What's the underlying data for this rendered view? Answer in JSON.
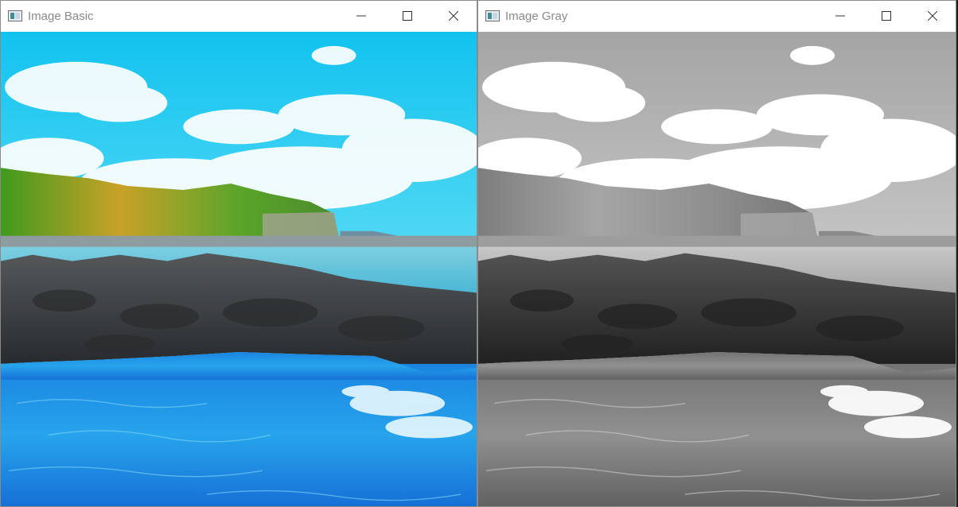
{
  "windows": [
    {
      "title": "Image Basic",
      "controls": [
        "minimize",
        "maximize",
        "close"
      ],
      "image": {
        "subject": "coastal-landscape",
        "color_mode": "color"
      }
    },
    {
      "title": "Image Gray",
      "controls": [
        "minimize",
        "maximize",
        "close"
      ],
      "image": {
        "subject": "coastal-landscape",
        "color_mode": "grayscale"
      }
    }
  ],
  "colors": {
    "title_text": "#8a8a8a",
    "window_bg": "#ffffff",
    "sky": "#2ad0f0",
    "water": "#1a8fe6",
    "grass": "#4ea62a",
    "rock": "#3b3d3f"
  }
}
